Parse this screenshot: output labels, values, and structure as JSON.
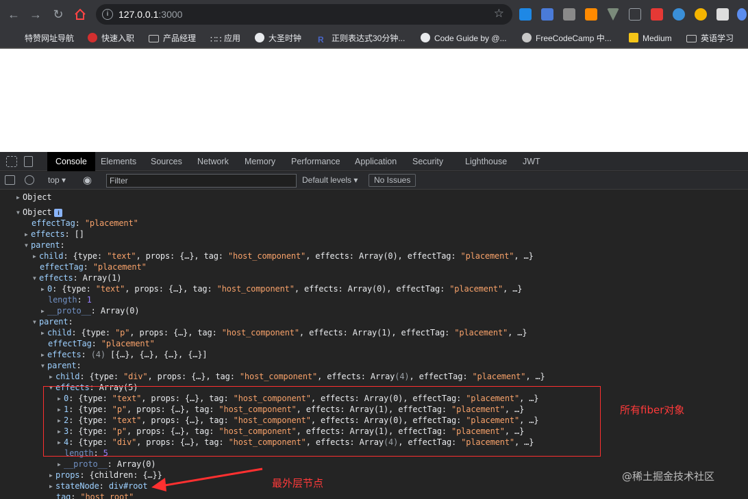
{
  "browser": {
    "url_host": "127.0.0.1",
    "url_port": ":3000",
    "nav_icons": [
      "back-icon",
      "forward-icon",
      "reload-icon",
      "home-icon"
    ],
    "bookmarks": [
      {
        "label": "特赞网址导航",
        "icon": "stripe-icon"
      },
      {
        "label": "快速入职",
        "icon": "circle-arrow-icon"
      },
      {
        "label": "产品经理",
        "icon": "folder-icon"
      },
      {
        "label": "应用",
        "icon": "apps-grid-icon"
      },
      {
        "label": "大圣时钟",
        "icon": "globe-icon"
      },
      {
        "label": "正则表达式30分钟...",
        "icon": "regex-icon"
      },
      {
        "label": "Code Guide by @...",
        "icon": "globe-icon"
      },
      {
        "label": "FreeCodeCamp 中...",
        "icon": "github-icon"
      },
      {
        "label": "Medium",
        "icon": "medium-icon"
      },
      {
        "label": "英语学习",
        "icon": "folder-icon"
      }
    ]
  },
  "devtools": {
    "tabs": [
      "Console",
      "Elements",
      "Sources",
      "Network",
      "Memory",
      "Performance",
      "Application",
      "Security",
      "Lighthouse",
      "JWT"
    ],
    "active_tab": "Console",
    "context": "top",
    "filter_placeholder": "Filter",
    "levels": "Default levels",
    "issues": "No Issues"
  },
  "console": {
    "collapsed_object": "Object",
    "object_label": "Object",
    "lines": [
      "effectTag: \"placement\"",
      "effects: []",
      "parent:",
      "child: {type: \"text\", props: {…}, tag: \"host_component\", effects: Array(0), effectTag: \"placement\", …}",
      "effectTag: \"placement\"",
      "effects: Array(1)",
      "0: {type: \"text\", props: {…}, tag: \"host_component\", effects: Array(0), effectTag: \"placement\", …}",
      "length: 1",
      "__proto__: Array(0)",
      "parent:",
      "child: {type: \"p\", props: {…}, tag: \"host_component\", effects: Array(1), effectTag: \"placement\", …}",
      "effectTag: \"placement\"",
      "effects: (4) [{…}, {…}, {…}, {…}]",
      "parent:",
      "child: {type: \"div\", props: {…}, tag: \"host_component\", effects: Array(4), effectTag: \"placement\", …}",
      "effects: Array(5)",
      "0: {type: \"text\", props: {…}, tag: \"host_component\", effects: Array(0), effectTag: \"placement\", …}",
      "1: {type: \"p\", props: {…}, tag: \"host_component\", effects: Array(1), effectTag: \"placement\", …}",
      "2: {type: \"text\", props: {…}, tag: \"host_component\", effects: Array(0), effectTag: \"placement\", …}",
      "3: {type: \"p\", props: {…}, tag: \"host_component\", effects: Array(1), effectTag: \"placement\", …}",
      "4: {type: \"div\", props: {…}, tag: \"host_component\", effects: Array(4), effectTag: \"placement\", …}",
      "length: 5",
      "__proto__: Array(0)",
      "props: {children: {…}}",
      "stateNode: div#root",
      "tag: \"host_root\""
    ]
  },
  "annotations": {
    "all_fibers": "所有fiber对象",
    "outermost_node": "最外层节点",
    "watermark": "@稀土掘金技术社区"
  },
  "colors": {
    "chrome_bg": "#35363a",
    "devtools_bg": "#242424",
    "annotation_red": "#ff3a3a"
  }
}
